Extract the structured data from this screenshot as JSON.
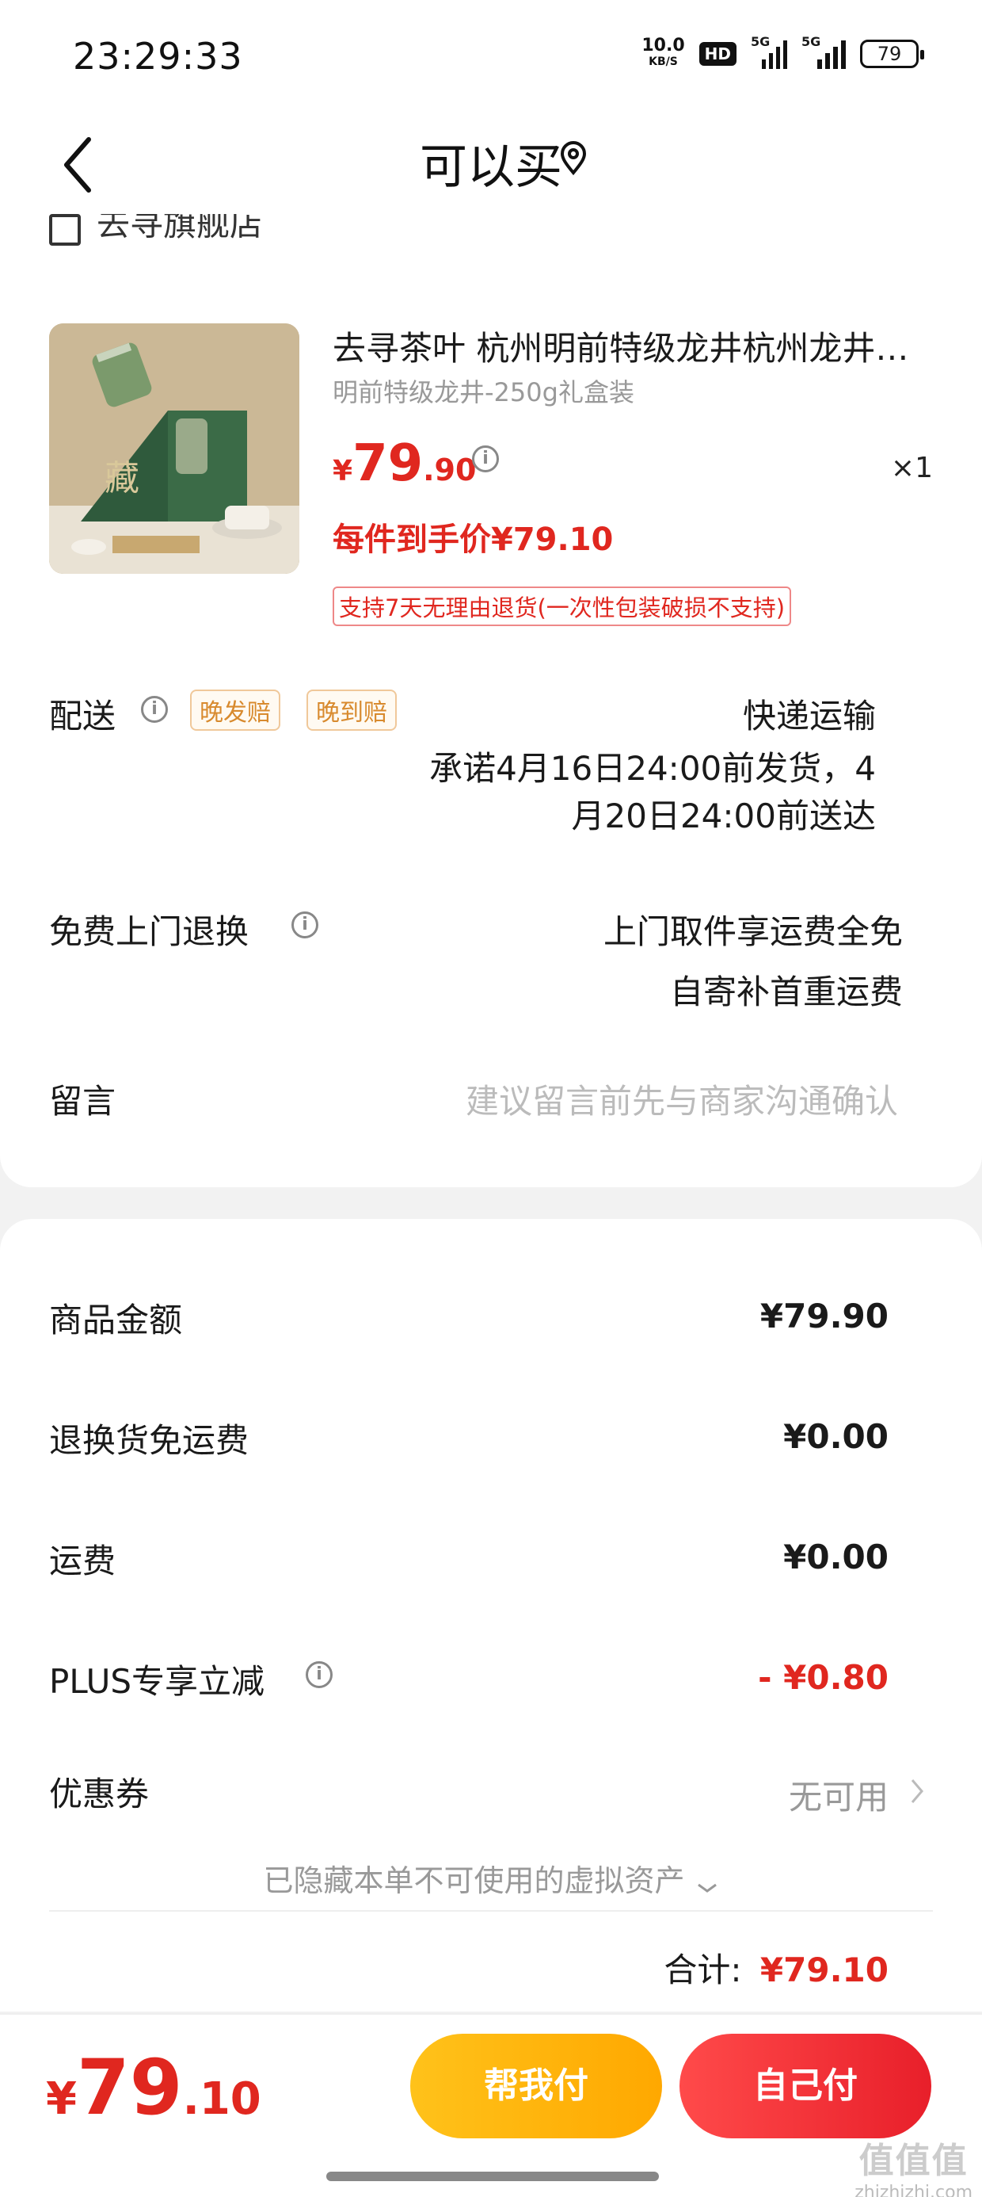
{
  "status_bar": {
    "time": "23:29:33",
    "net_speed": "10.0",
    "net_unit": "KB/S",
    "hd": "HD",
    "sig1": "5G",
    "sig2": "5G",
    "battery": "79"
  },
  "nav": {
    "title": "可以买"
  },
  "shop": {
    "name": "去寻旗舰店"
  },
  "product": {
    "title": "去寻茶叶  杭州明前特级龙井杭州龙井茶叶绿茶",
    "spec": "明前特级龙井-250g礼盒装",
    "price_symbol": "¥",
    "price_int": "79",
    "price_dec": ".90",
    "quantity": "×1",
    "unit_price": "每件到手价¥79.10",
    "return_policy": "支持7天无理由退货(一次性包装破损不支持)"
  },
  "delivery": {
    "label": "配送",
    "tag1": "晚发赔",
    "tag2": "晚到赔",
    "method": "快递运输",
    "promise_line1": "承诺4月16日24:00前发货，4",
    "promise_line2": "月20日24:00前送达"
  },
  "free_return": {
    "label": "免费上门退换",
    "line1": "上门取件享运费全免",
    "line2": "自寄补首重运费"
  },
  "message": {
    "label": "留言",
    "placeholder": "建议留言前先与商家沟通确认"
  },
  "summary": {
    "goods_label": "商品金额",
    "goods_value": "¥79.90",
    "return_ship_label": "退换货免运费",
    "return_ship_value": "¥0.00",
    "shipping_label": "运费",
    "shipping_value": "¥0.00",
    "plus_label": "PLUS专享立减",
    "plus_value": "- ¥0.80",
    "coupon_label": "优惠券",
    "coupon_value": "无可用",
    "hidden_assets": "已隐藏本单不可使用的虚拟资产",
    "total_label": "合计:",
    "total_value": "¥79.10"
  },
  "bottom": {
    "price_symbol": "¥",
    "price_int": "79",
    "price_dec": ".10",
    "help_pay": "帮我付",
    "self_pay": "自己付"
  },
  "watermark": {
    "logo": "值值值",
    "site": "zhizhizhi.com"
  },
  "colors": {
    "accent_red": "#e0271f",
    "help_yellow": "#ffb800",
    "self_red": "#ef2d34"
  }
}
